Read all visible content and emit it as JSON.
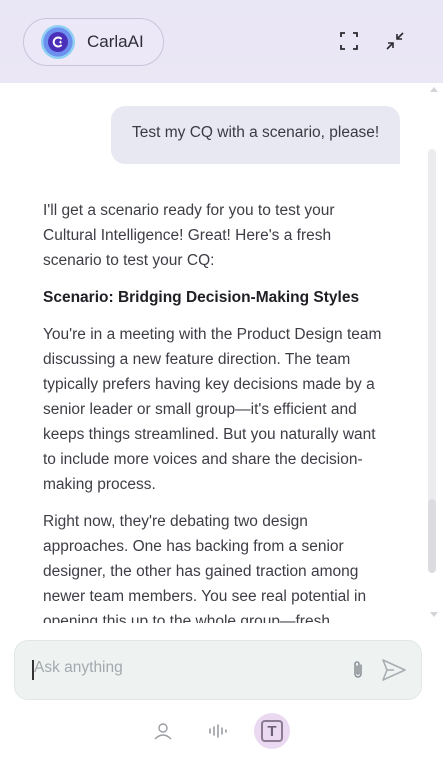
{
  "header": {
    "brand_name": "CarlaAI"
  },
  "chat": {
    "user_message": "Test my CQ with a scenario, please!",
    "reply": {
      "intro": "I'll get a scenario ready for you to test your Cultural Intelligence! Great! Here's a fresh scenario to test your CQ:",
      "heading": "Scenario: Bridging Decision-Making Styles",
      "para1": "You're in a meeting with the Product Design team discussing a new feature direction. The team typically prefers having key decisions made by a senior leader or small group—it's efficient and keeps things streamlined. But you naturally want to include more voices and share the decision-making process.",
      "para2": "Right now, they're debating two design approaches. One has backing from a senior designer, the other has gained traction among newer team members. You see real potential in opening this up to the whole group—fresh"
    }
  },
  "composer": {
    "placeholder": "Ask anything"
  },
  "bottom_bar": {
    "text_mode_letter": "T"
  },
  "colors": {
    "header_bg": "#ebe7f5",
    "user_bubble_bg": "#e7e8f1",
    "input_bg": "#eef3f2",
    "active_mode_bg": "#ead9f1"
  }
}
